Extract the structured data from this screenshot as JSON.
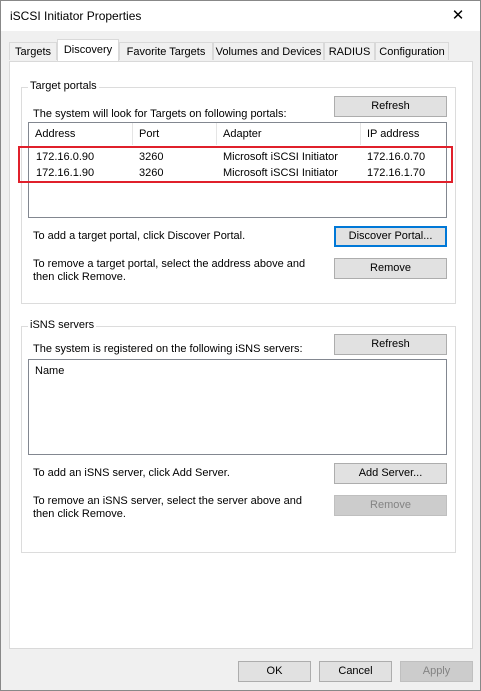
{
  "window": {
    "title": "iSCSI Initiator Properties",
    "close_glyph": "✕"
  },
  "tabs": [
    "Targets",
    "Discovery",
    "Favorite Targets",
    "Volumes and Devices",
    "RADIUS",
    "Configuration"
  ],
  "target_portals": {
    "legend": "Target portals",
    "info": "The system will look for Targets on following portals:",
    "refresh_label": "Refresh",
    "columns": [
      "Address",
      "Port",
      "Adapter",
      "IP address"
    ],
    "rows": [
      [
        "172.16.0.90",
        "3260",
        "Microsoft iSCSI Initiator",
        "172.16.0.70"
      ],
      [
        "172.16.1.90",
        "3260",
        "Microsoft iSCSI Initiator",
        "172.16.1.70"
      ]
    ],
    "add_text": "To add a target portal, click Discover Portal.",
    "discover_label": "Discover Portal...",
    "remove_text_1": "To remove a target portal, select the address above and",
    "remove_text_2": "then click Remove.",
    "remove_label": "Remove"
  },
  "isns": {
    "legend": "iSNS servers",
    "info": "The system is registered on the following iSNS servers:",
    "refresh_label": "Refresh",
    "column": "Name",
    "add_text": "To add an iSNS server, click Add Server.",
    "add_label": "Add Server...",
    "remove_text_1": "To remove an iSNS server, select the server above and",
    "remove_text_2": "then click Remove.",
    "remove_label": "Remove"
  },
  "footer": {
    "ok": "OK",
    "cancel": "Cancel",
    "apply": "Apply"
  },
  "colors": {
    "highlight_border": "#e0202b",
    "focus_border": "#0078d7"
  }
}
